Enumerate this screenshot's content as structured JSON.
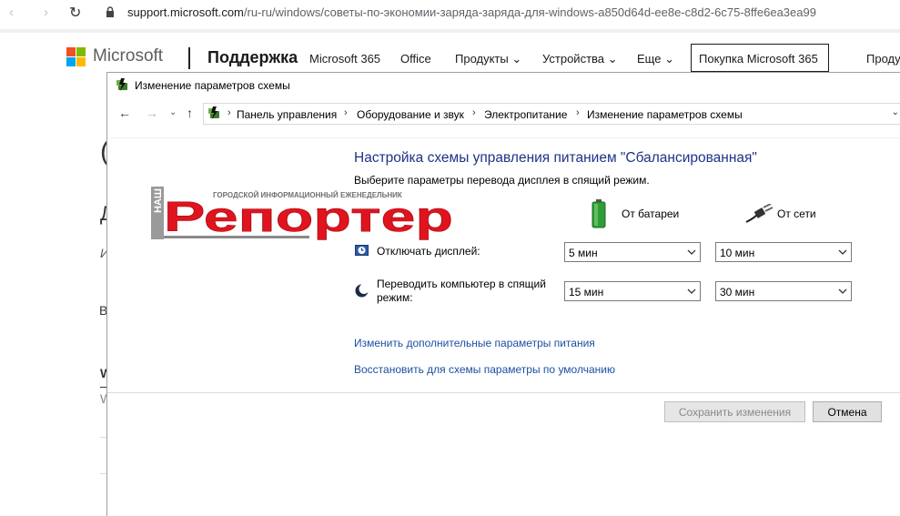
{
  "browser": {
    "url_prefix": "support.microsoft.com",
    "url_rest": "/ru-ru/windows/советы-по-экономии-заряда-заряда-для-windows-a850d64d-ee8e-c8d2-6c75-8ffe6ea3ea99"
  },
  "ms_header": {
    "brand": "Microsoft",
    "support": "Поддержка",
    "nav": [
      "Microsoft 365",
      "Office",
      "Продукты",
      "Устройства",
      "Еще"
    ],
    "buy_button": "Покупка Microsoft 365",
    "products_cut": "Проду"
  },
  "background_fragments": [
    "(",
    "Д",
    "И",
    "В",
    "W",
    "W"
  ],
  "watermark": {
    "small_word": "НАШ",
    "tagline": "ГОРОДСКОЙ ИНФОРМАЦИОННЫЙ ЕЖЕНЕДЕЛЬНИК",
    "big_word": "Репортер"
  },
  "dialog": {
    "title": "Изменение параметров схемы",
    "breadcrumbs": [
      "Панель управления",
      "Оборудование и звук",
      "Электропитание",
      "Изменение параметров схемы"
    ],
    "heading": "Настройка схемы управления питанием \"Сбалансированная\"",
    "subtitle": "Выберите параметры перевода дисплея в спящий режим.",
    "columns": {
      "battery": "От батареи",
      "plugged": "От сети"
    },
    "settings": [
      {
        "label": "Отключать дисплей:",
        "battery": "5 мин",
        "plugged": "10 мин"
      },
      {
        "label": "Переводить компьютер в спящий режим:",
        "battery": "15 мин",
        "plugged": "30 мин"
      }
    ],
    "links": {
      "advanced": "Изменить дополнительные параметры питания",
      "restore": "Восстановить для схемы параметры по умолчанию"
    },
    "buttons": {
      "save": "Сохранить изменения",
      "cancel": "Отмена"
    }
  },
  "colors": {
    "heading": "#1e3287",
    "link": "#1c4fa3",
    "watermark_red": "#e0141e",
    "ms_red": "#f25022",
    "ms_green": "#7fba00",
    "ms_blue": "#00a4ef",
    "ms_yellow": "#ffb900"
  }
}
